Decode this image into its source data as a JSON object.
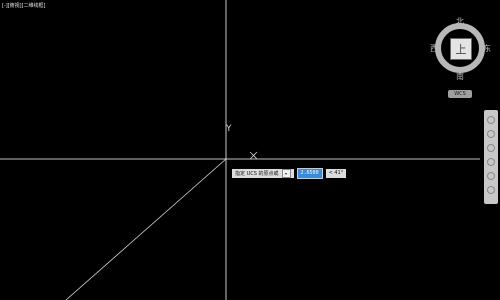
{
  "viewport": {
    "label": "[-][俯视][二维线框]"
  },
  "ucs_icon": {
    "y_label": "Y"
  },
  "viewcube": {
    "north": "北",
    "south": "南",
    "east": "东",
    "west": "西",
    "face": "上",
    "wcs_label": "WCS"
  },
  "dynamic_input": {
    "prompt": "指定 UCS 的原点或",
    "value": "2.6500",
    "angle": "< 41°"
  },
  "colors": {
    "background": "#000000",
    "crosshair": "#ffffff",
    "input_highlight": "#3a8bd8"
  }
}
